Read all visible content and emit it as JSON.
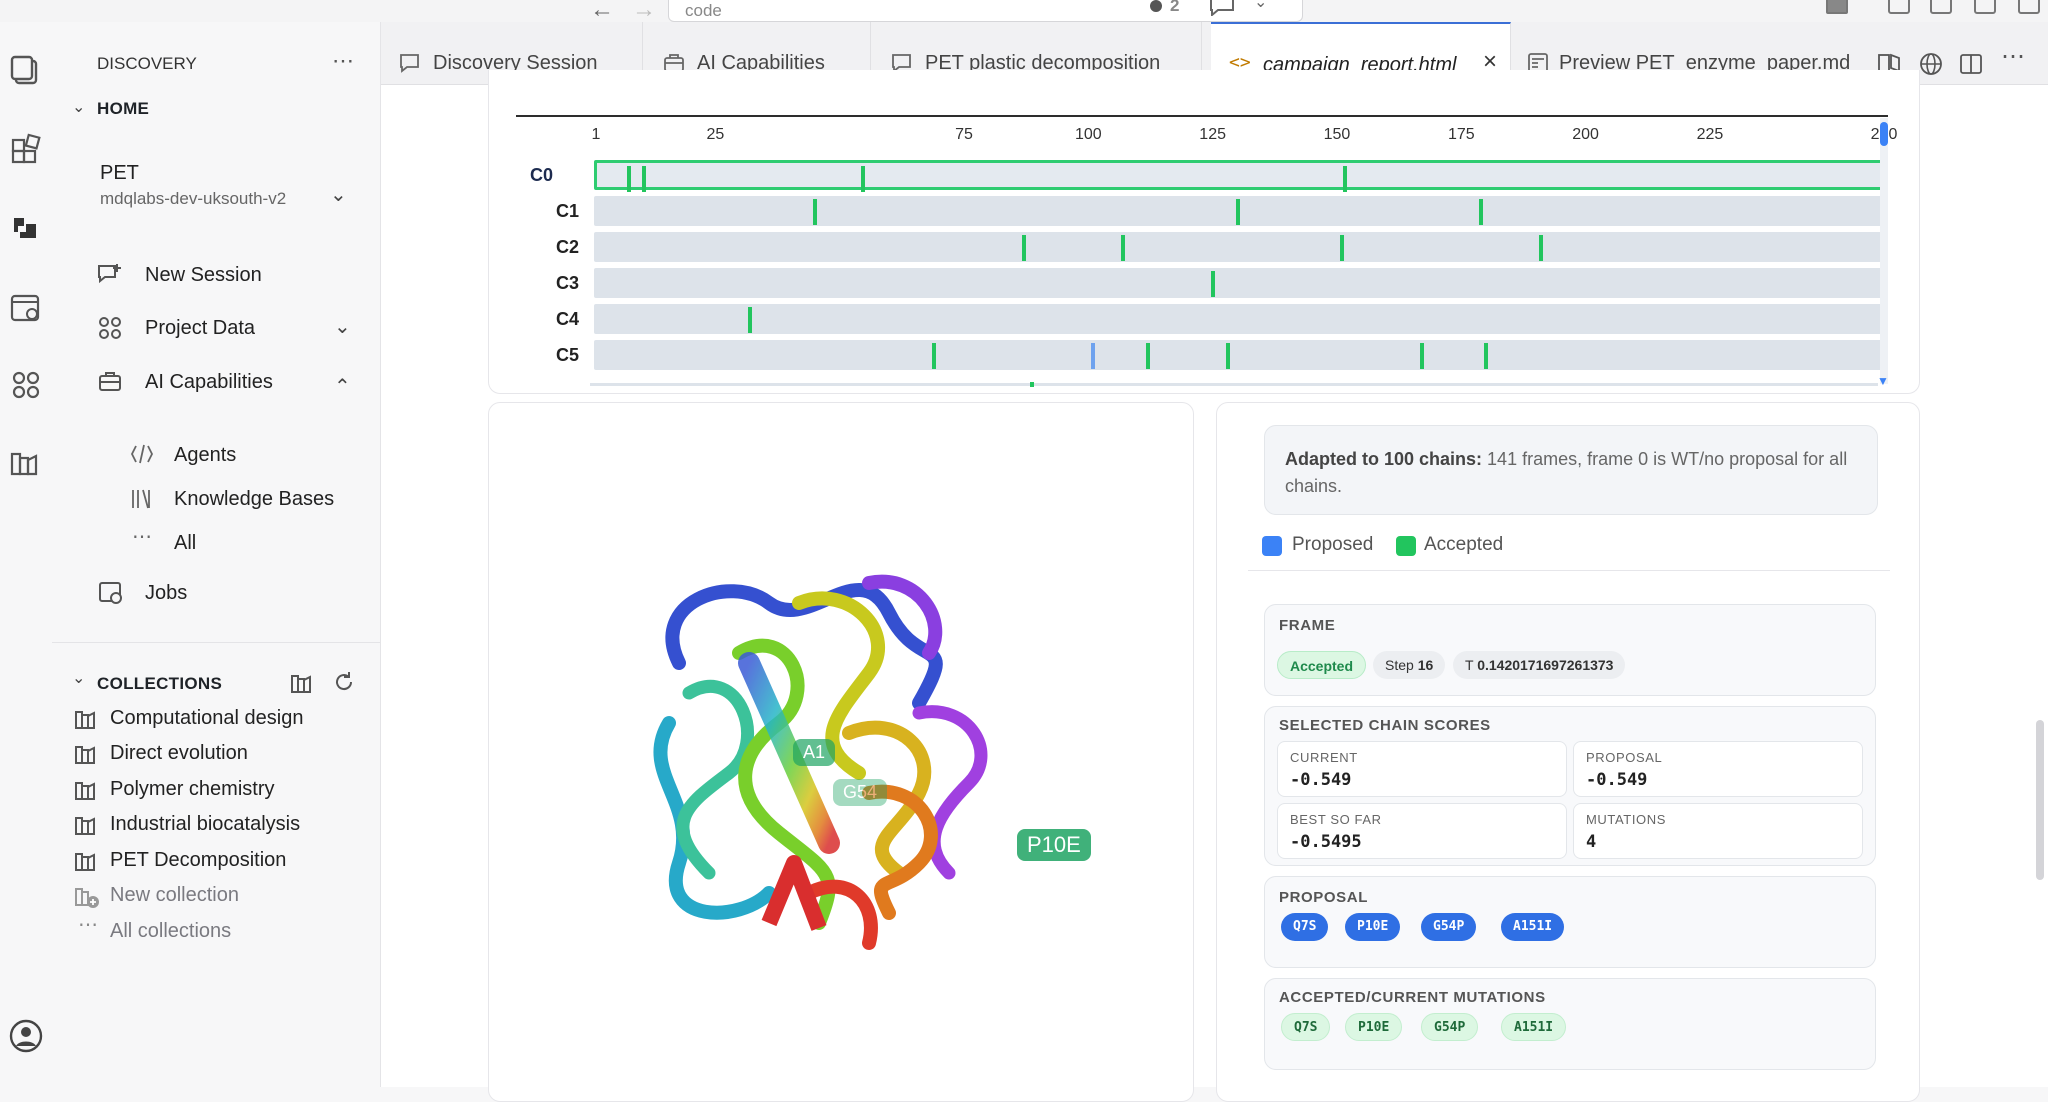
{
  "titlebar": {
    "address_text": "code",
    "notifications_count": "2"
  },
  "sidebar": {
    "header": "DISCOVERY",
    "home_label": "HOME",
    "project": {
      "name": "PET",
      "workspace": "mdqlabs-dev-uksouth-v2"
    },
    "items": [
      {
        "label": "New Session"
      },
      {
        "label": "Project Data"
      },
      {
        "label": "AI Capabilities"
      }
    ],
    "sub_items": [
      {
        "label": "Agents"
      },
      {
        "label": "Knowledge Bases"
      },
      {
        "label": "All"
      }
    ],
    "jobs_label": "Jobs",
    "collections_label": "COLLECTIONS",
    "collections": [
      {
        "label": "Computational design"
      },
      {
        "label": "Direct evolution"
      },
      {
        "label": "Polymer chemistry"
      },
      {
        "label": "Industrial biocatalysis"
      },
      {
        "label": "PET Decomposition"
      }
    ],
    "new_collection": "New collection",
    "all_collections": "All collections"
  },
  "tabs": [
    {
      "label": "Discovery Session"
    },
    {
      "label": "AI Capabilities"
    },
    {
      "label": "PET plastic decomposition"
    },
    {
      "label": "campaign_report.html"
    },
    {
      "label": "Preview PET_enzyme_paper.md"
    }
  ],
  "chart_data": {
    "type": "table",
    "x_ticks": [
      "1",
      "25",
      "75",
      "100",
      "125",
      "150",
      "175",
      "200",
      "225",
      "260"
    ],
    "x_tick_positions": [
      1,
      25,
      75,
      100,
      125,
      150,
      175,
      200,
      225,
      260
    ],
    "xlim": [
      1,
      260
    ],
    "rows": [
      {
        "label": "C0",
        "selected": true,
        "marks": [
          7,
          10,
          54,
          151
        ]
      },
      {
        "label": "C1",
        "marks": [
          45,
          130,
          179
        ]
      },
      {
        "label": "C2",
        "marks": [
          87,
          107,
          151,
          191
        ]
      },
      {
        "label": "C3",
        "marks": [
          125
        ]
      },
      {
        "label": "C4",
        "marks": [
          32
        ]
      },
      {
        "label": "C5",
        "marks": [
          69,
          112,
          128,
          167,
          180
        ],
        "proposed_marks": [
          101
        ]
      }
    ],
    "legend": [
      "Proposed",
      "Accepted"
    ],
    "colors": {
      "proposed": "#3b82f6",
      "accepted": "#22c55e"
    }
  },
  "viewer": {
    "labels": [
      "P10E",
      "A1",
      "G54"
    ]
  },
  "info": {
    "note_bold": "Adapted to 100 chains:",
    "note_rest": " 141 frames, frame 0 is WT/no proposal for all chains.",
    "legend_proposed": "Proposed",
    "legend_accepted": "Accepted"
  },
  "frame": {
    "title": "FRAME",
    "status": "Accepted",
    "step_label": "Step",
    "step_value": "16",
    "temp_label": "T",
    "temp_value": "0.1420171697261373"
  },
  "scores": {
    "title": "SELECTED CHAIN SCORES",
    "current_label": "CURRENT",
    "current_value": "-0.549",
    "proposal_label": "PROPOSAL",
    "proposal_value": "-0.549",
    "best_label": "BEST SO FAR",
    "best_value": "-0.5495",
    "mutations_label": "MUTATIONS",
    "mutations_value": "4"
  },
  "proposal": {
    "title": "PROPOSAL",
    "items": [
      "Q7S",
      "P10E",
      "G54P",
      "A151I"
    ]
  },
  "accepted": {
    "title": "ACCEPTED/CURRENT MUTATIONS",
    "items": [
      "Q7S",
      "P10E",
      "G54P",
      "A151I"
    ]
  }
}
